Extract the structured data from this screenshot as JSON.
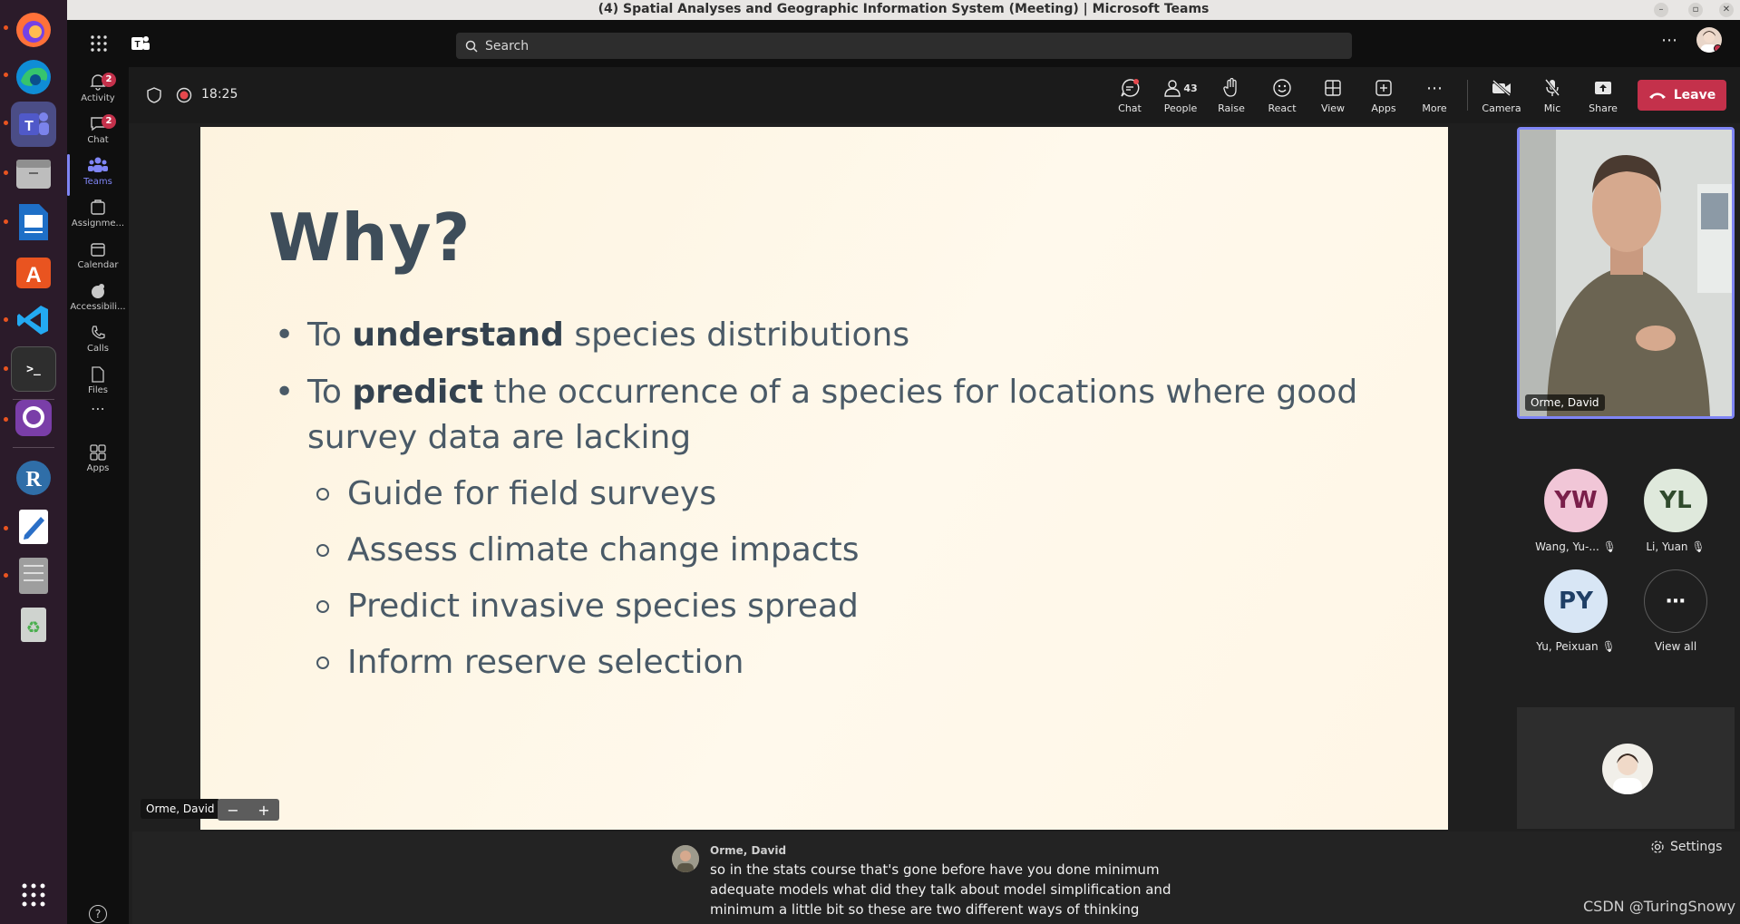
{
  "window": {
    "title": "(4) Spatial Analyses and Geographic Information System (Meeting) | Microsoft Teams"
  },
  "search": {
    "placeholder": "Search"
  },
  "rail": {
    "items": [
      {
        "label": "Activity",
        "badge": "2"
      },
      {
        "label": "Chat",
        "badge": "2"
      },
      {
        "label": "Teams"
      },
      {
        "label": "Assignme..."
      },
      {
        "label": "Calendar"
      },
      {
        "label": "Accessibili..."
      },
      {
        "label": "Calls"
      },
      {
        "label": "Files"
      },
      {
        "label": "Apps"
      }
    ]
  },
  "meeting": {
    "timer": "18:25",
    "toolbar": {
      "chat": "Chat",
      "people": "People",
      "people_count": "43",
      "raise": "Raise",
      "react": "React",
      "view": "View",
      "apps": "Apps",
      "more": "More",
      "camera": "Camera",
      "mic": "Mic",
      "share": "Share",
      "leave": "Leave"
    }
  },
  "slide": {
    "title": "Why?",
    "bullet1": {
      "pre": "To ",
      "bold": "understand",
      "post": " species distributions"
    },
    "bullet2": {
      "pre": "To ",
      "bold": "predict",
      "line1_rest": " the occurrence of a species for locations where good",
      "line2": "survey data are lacking"
    },
    "sub": [
      "Guide for field surveys",
      "Assess climate change impacts",
      "Predict invasive species spread",
      "Inform reserve selection"
    ]
  },
  "presenter_tag": "Orme, David",
  "zoom": {
    "minus": "−",
    "plus": "+"
  },
  "participants": {
    "video_name": "Orme, David",
    "tiles": [
      {
        "initials": "YW",
        "name": "Wang, Yu-...",
        "color": "#f1c6d7",
        "text_color": "#7a1f4a"
      },
      {
        "initials": "YL",
        "name": "Li, Yuan",
        "color": "#dfe9dc",
        "text_color": "#2f4a2c"
      },
      {
        "initials": "PY",
        "name": "Yu, Peixuan",
        "color": "#d8e6f5",
        "text_color": "#1f3f66"
      }
    ],
    "view_all": "View all"
  },
  "captions": {
    "speaker": "Orme, David",
    "lines": [
      "so in the stats course that's gone before have you done minimum",
      "adequate models what did they talk about model simplification and",
      "minimum a little bit so these are two different ways of thinking"
    ],
    "settings": "Settings"
  },
  "watermark": "CSDN @TuringSnowy",
  "colors": {
    "accent": "#7f85f5",
    "leave": "#c4314b",
    "badge": "#c4314b"
  }
}
